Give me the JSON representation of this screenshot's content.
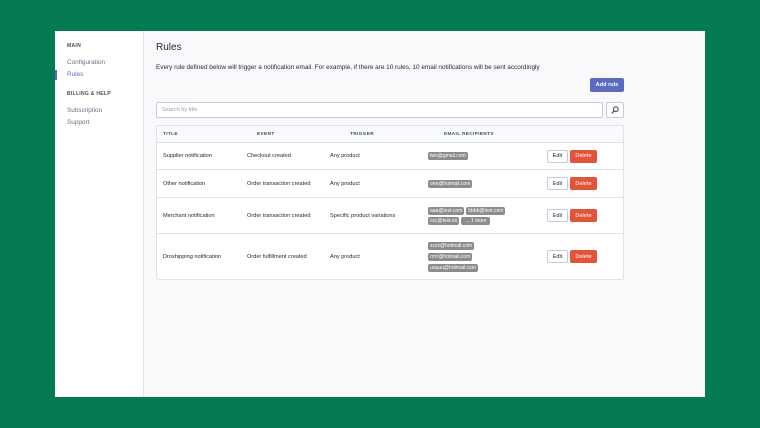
{
  "sidebar": {
    "main_heading": "MAIN",
    "main_items": [
      {
        "label": "Configuration",
        "active": false
      },
      {
        "label": "Rules",
        "active": true
      }
    ],
    "billing_heading": "BILLING & HELP",
    "billing_items": [
      {
        "label": "Subscription"
      },
      {
        "label": "Support"
      }
    ]
  },
  "page": {
    "title": "Rules",
    "description": "Every rule defined below will trigger a notification email. For example, if there are 10 rules, 10 email notifications will be sent accordingly",
    "add_button": "Add rule"
  },
  "search": {
    "placeholder": "Search by title",
    "icon": "search-icon"
  },
  "table": {
    "headers": [
      "TITLE",
      "EVENT",
      "TRIGGER",
      "EMAIL RECIPIENTS"
    ],
    "rows": [
      {
        "title": "Supplier notification",
        "event": "Checkout created",
        "trigger": "Any product",
        "recipients": [
          "two@gmail.com"
        ],
        "edit": "Edit",
        "delete": "Delete"
      },
      {
        "title": "Other notification",
        "event": "Order transaction created",
        "trigger": "Any product",
        "recipients": [
          "one@hotmail.com"
        ],
        "edit": "Edit",
        "delete": "Delete"
      },
      {
        "title": "Merchant notification",
        "event": "Order transaction created",
        "trigger": "Specific product variations",
        "recipients": [
          "aaa@test.com",
          "bbbb@test.com",
          "ccc@test.es"
        ],
        "more": "... 1 more",
        "edit": "Edit",
        "delete": "Delete"
      },
      {
        "title": "Droshipping notification",
        "event": "Order fulfillment created",
        "trigger": "Any product",
        "recipients": [
          "zzzz@hotmail.com",
          "rrrrr@hotmail.com",
          "uuuuu@hotmail.com"
        ],
        "edit": "Edit",
        "delete": "Delete"
      }
    ]
  },
  "colors": {
    "background": "#047a55",
    "accent": "#5c6ac4",
    "delete": "#de3618",
    "tag": "#8c8c8c"
  }
}
